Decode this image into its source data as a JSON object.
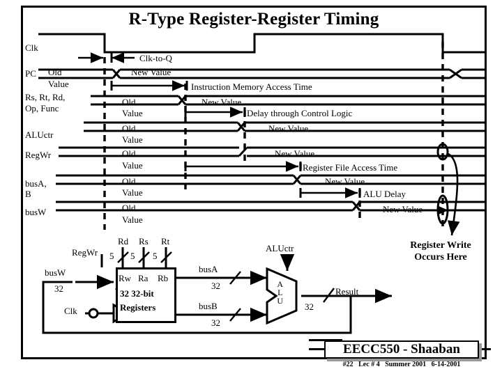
{
  "title": "R-Type Register-Register Timing",
  "signals": [
    {
      "name": "Clk",
      "old": "",
      "oldv": "",
      "new": ""
    },
    {
      "name": "PC",
      "old": "Old",
      "oldv": "Value",
      "new": "New Value"
    },
    {
      "name": "Rs, Rt, Rd,\nOp, Func",
      "old": "Old",
      "oldv": "Value",
      "new": "New Value"
    },
    {
      "name": "ALUctr",
      "old": "Old",
      "oldv": "Value",
      "new": "New Value"
    },
    {
      "name": "RegWr",
      "old": "Old",
      "oldv": "Value",
      "new": "New Value"
    },
    {
      "name": "busA,\nB",
      "old": "Old",
      "oldv": "Value",
      "new": "New Value"
    },
    {
      "name": "busW",
      "old": "Old",
      "oldv": "Value",
      "new": "New Value"
    }
  ],
  "signal_labels": {
    "clk": "Clk",
    "pc": "PC",
    "instr_line1": "Rs, Rt, Rd,",
    "instr_line2": "Op, Func",
    "aluctr": "ALUctr",
    "regwr": "RegWr",
    "busab_line1": "busA,",
    "busab_line2": "B",
    "busw": "busW"
  },
  "values": {
    "old": "Old",
    "old_value": "Value",
    "new_value": "New Value"
  },
  "annotations": {
    "clk_to_q": "Clk-to-Q",
    "imem": "Instruction Memory Access Time",
    "ctrl_delay": "Delay through Control Logic",
    "regfile": "Register File Access Time",
    "alu_delay": "ALU Delay",
    "reg_write_line1": "Register Write",
    "reg_write_line2": "Occurs Here"
  },
  "datapath": {
    "regwr": "RegWr",
    "rd": "Rd",
    "rs": "Rs",
    "rt": "Rt",
    "width5_a": "5",
    "width5_b": "5",
    "width5_c": "5",
    "rw": "Rw",
    "ra": "Ra",
    "rb": "Rb",
    "block_line1": "32 32-bit",
    "block_line2": "Registers",
    "busw": "busW",
    "busw_width": "32",
    "clk": "Clk",
    "busa": "busA",
    "busa_width": "32",
    "busb": "busB",
    "busb_width": "32",
    "aluctr": "ALUctr",
    "alu": "ALU",
    "result": "Result",
    "result_width": "32"
  },
  "footer": {
    "course": "EECC550 - Shaaban",
    "slide": "#22",
    "lecture": "Lec # 4",
    "term": "Summer 2001",
    "date": "6-14-2001"
  }
}
